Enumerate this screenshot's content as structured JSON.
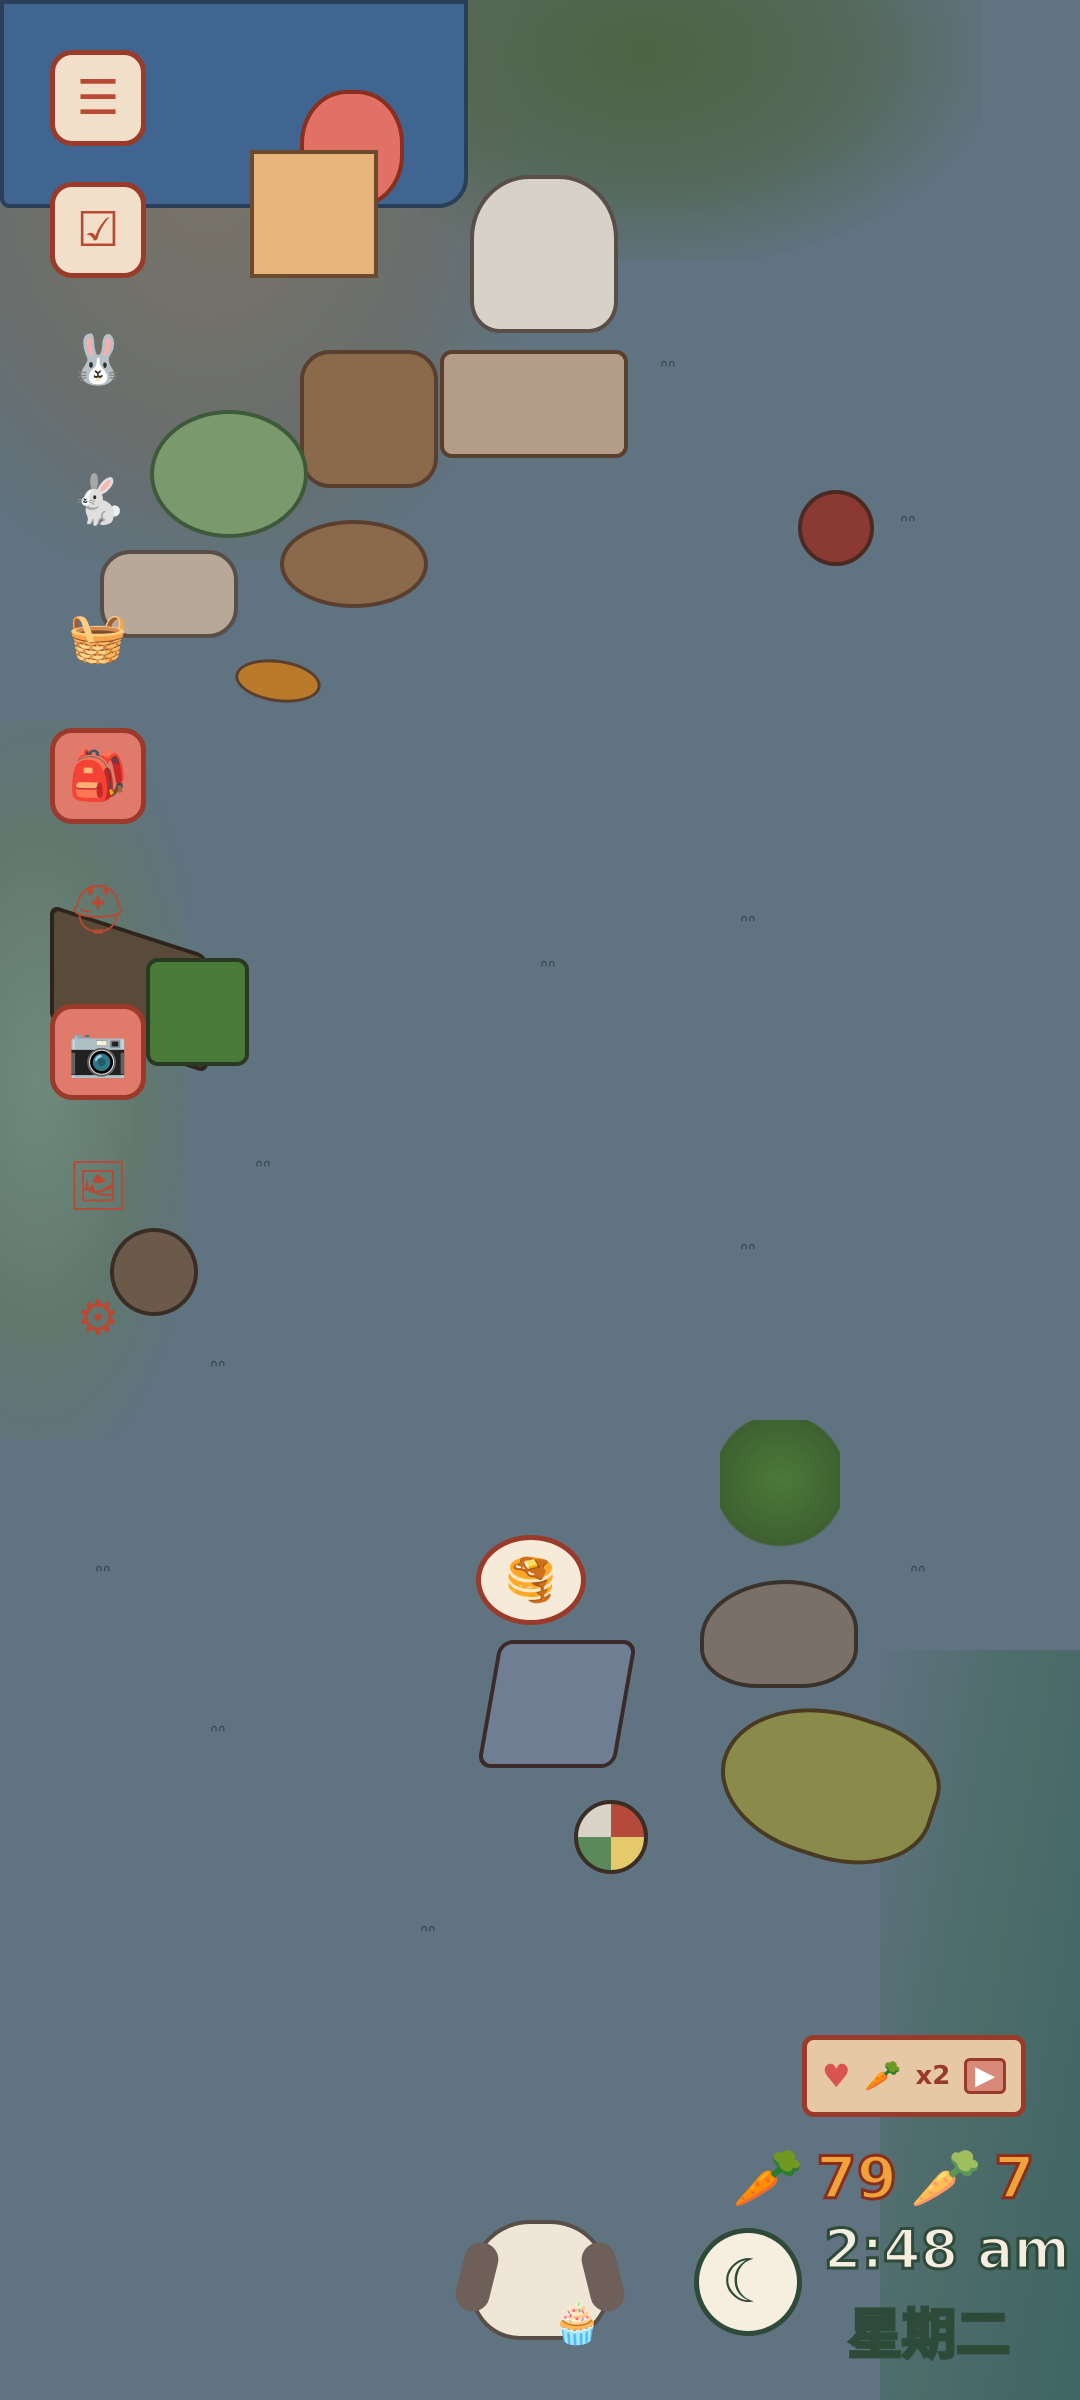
{
  "menu": {
    "items": [
      {
        "name": "menu",
        "icon": "☰"
      },
      {
        "name": "tasks",
        "icon": "☑"
      },
      {
        "name": "bunny-album",
        "icon": "🐰"
      },
      {
        "name": "bunny-list",
        "icon": "🐇"
      },
      {
        "name": "basket",
        "icon": "🧺"
      },
      {
        "name": "backpack",
        "icon": "🎒"
      },
      {
        "name": "build",
        "icon": "⛑"
      },
      {
        "name": "camera",
        "icon": "📷"
      },
      {
        "name": "photos",
        "icon": "🖼"
      },
      {
        "name": "settings",
        "icon": "⚙"
      }
    ]
  },
  "bonus": {
    "heart_icon": "♥",
    "carrot_icon": "🥕",
    "multiplier": "x2",
    "video_icon": "▶"
  },
  "currency": {
    "carrots": "79",
    "golden_carrots": "7"
  },
  "clock": {
    "time": "2:48 am",
    "weekday": "星期二"
  },
  "colors": {
    "ground": "#5f7380",
    "ui_border": "#9a3a2a",
    "carrot": "#f0a23a",
    "text_outline": "#2e4a38"
  }
}
